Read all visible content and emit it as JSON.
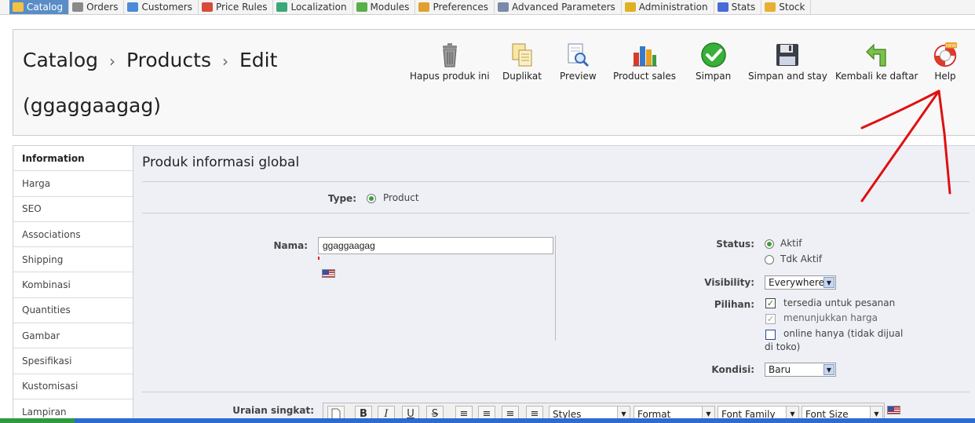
{
  "nav": {
    "tabs": [
      {
        "label": "Catalog",
        "icon": "folder-icon",
        "active": true
      },
      {
        "label": "Orders",
        "icon": "cart-icon"
      },
      {
        "label": "Customers",
        "icon": "users-icon"
      },
      {
        "label": "Price Rules",
        "icon": "tag-icon"
      },
      {
        "label": "Localization",
        "icon": "globe-icon"
      },
      {
        "label": "Modules",
        "icon": "puzzle-icon"
      },
      {
        "label": "Preferences",
        "icon": "preferences-icon"
      },
      {
        "label": "Advanced Parameters",
        "icon": "wrench-icon"
      },
      {
        "label": "Administration",
        "icon": "key-icon"
      },
      {
        "label": "Stats",
        "icon": "chart-icon"
      },
      {
        "label": "Stock",
        "icon": "box-icon"
      }
    ]
  },
  "header": {
    "breadcrumb": [
      "Catalog",
      "Products",
      "Edit"
    ],
    "separator": "›",
    "product_name": "(ggaggaagag)",
    "toolbar": {
      "delete": "Hapus produk ini",
      "duplicate": "Duplikat",
      "preview": "Preview",
      "sales": "Product sales",
      "save": "Simpan",
      "save_stay": "Simpan and stay",
      "back": "Kembali ke daftar",
      "help": "Help",
      "help_badge": "NEW"
    }
  },
  "sidebar": {
    "items": [
      "Information",
      "Harga",
      "SEO",
      "Associations",
      "Shipping",
      "Kombinasi",
      "Quantities",
      "Gambar",
      "Spesifikasi",
      "Kustomisasi",
      "Lampiran"
    ]
  },
  "form": {
    "title": "Produk informasi global",
    "type_label": "Type:",
    "type_value": "Product",
    "name_label": "Nama:",
    "name_value": "ggaggaagag",
    "status_label": "Status:",
    "status_active": "Aktif",
    "status_inactive": "Tdk Aktif",
    "visibility_label": "Visibility:",
    "visibility_value": "Everywhere",
    "options_label": "Pilihan:",
    "opt_available": "tersedia untuk pesanan",
    "opt_show_price": "menunjukkan harga",
    "opt_online_only_1": "online hanya (tidak dijual",
    "opt_online_only_2": "di toko)",
    "condition_label": "Kondisi:",
    "condition_value": "Baru",
    "short_desc_label": "Uraian singkat:",
    "editor": {
      "bold": "B",
      "italic": "I",
      "underline": "U",
      "strike": "S",
      "styles": "Styles",
      "format": "Format",
      "font_family": "Font Family",
      "font_size": "Font Size"
    }
  },
  "colors": {
    "accent": "#5a8dc8",
    "annotation_arrow": "#e01010",
    "save_green": "#2fa82f"
  }
}
